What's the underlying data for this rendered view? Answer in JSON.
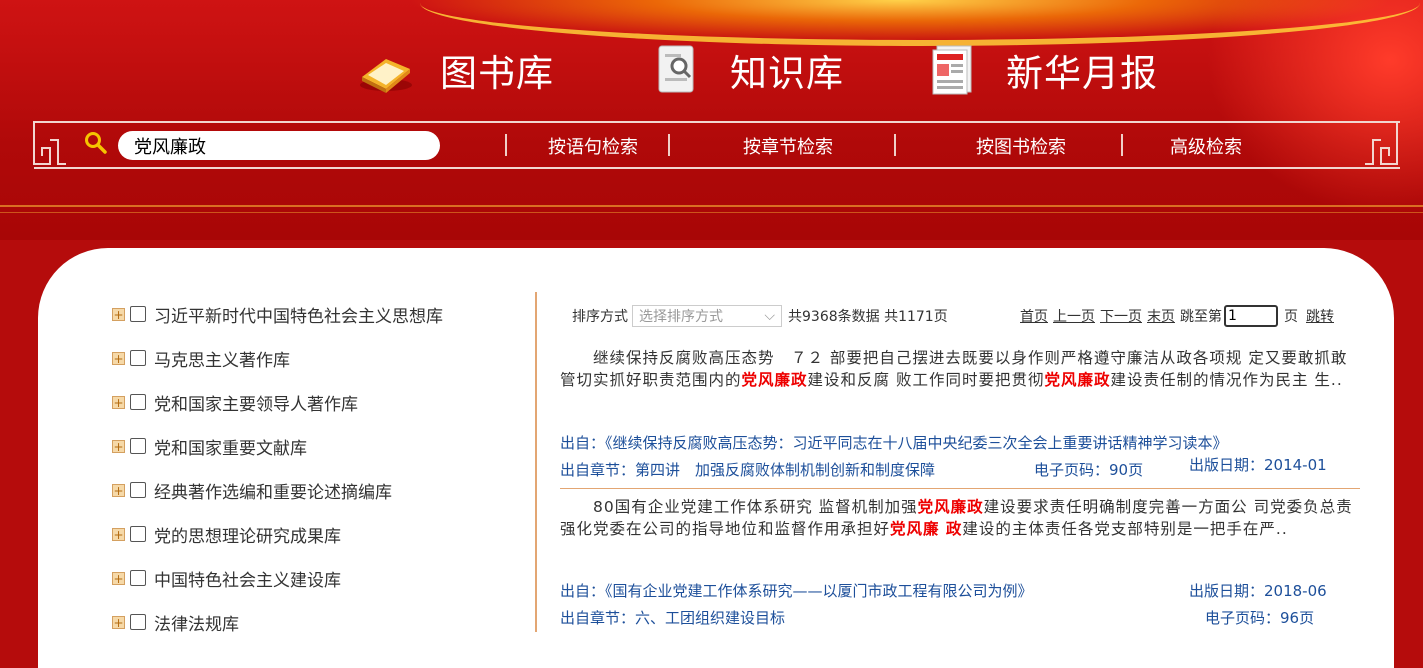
{
  "nav": {
    "tabs": [
      {
        "label": "图书库",
        "icon": "book-icon"
      },
      {
        "label": "知识库",
        "icon": "document-search-icon"
      },
      {
        "label": "新华月报",
        "icon": "newspaper-icon"
      }
    ]
  },
  "search": {
    "query": "党风廉政",
    "modes": [
      "按语句检索",
      "按章节检索",
      "按图书检索",
      "高级检索"
    ]
  },
  "sidebar": {
    "items": [
      {
        "label": "习近平新时代中国特色社会主义思想库"
      },
      {
        "label": "马克思主义著作库"
      },
      {
        "label": "党和国家主要领导人著作库"
      },
      {
        "label": "党和国家重要文献库"
      },
      {
        "label": "经典著作选编和重要论述摘编库"
      },
      {
        "label": "党的思想理论研究成果库"
      },
      {
        "label": "中国特色社会主义建设库"
      },
      {
        "label": "法律法规库"
      }
    ]
  },
  "toolbar": {
    "sort_label": "排序方式",
    "sort_placeholder": "选择排序方式",
    "stats": "共9368条数据 共1171页",
    "first": "首页",
    "prev": "上一页",
    "next": "下一页",
    "last": "末页",
    "jump_label": "跳至第",
    "page_value": "1",
    "page_unit": "页",
    "go": "跳转"
  },
  "results": [
    {
      "text_parts": [
        "　　继续保持反腐败高压态势　７２ 部要把自己摆进去既要以身作则严格遵守廉洁从政各项规 定又要敢抓敢管切实抓好职责范围内的",
        "党风廉政",
        "建设和反腐 败工作同时要把贯彻",
        "党风廉政",
        "建设责任制的情况作为民主 生.."
      ],
      "source": "出自：《继续保持反腐败高压态势：习近平同志在十八届中央纪委三次全会上重要讲话精神学习读本》",
      "chapter": "出自章节：第四讲　加强反腐败体制机制创新和制度保障",
      "page": "电子页码：90页",
      "date": "出版日期：2014-01"
    },
    {
      "text_parts": [
        "　　80国有企业党建工作体系研究 监督机制加强",
        "党风廉政",
        "建设要求责任明确制度完善一方面公 司党委负总责强化党委在公司的指导地位和监督作用承担好",
        "党风廉 政",
        "建设的主体责任各党支部特别是一把手在严.."
      ],
      "source": "出自：《国有企业党建工作体系研究——以厦门市政工程有限公司为例》",
      "chapter": "出自章节：六、工团组织建设目标",
      "page": "电子页码：96页",
      "date": "出版日期：2018-06"
    }
  ]
}
